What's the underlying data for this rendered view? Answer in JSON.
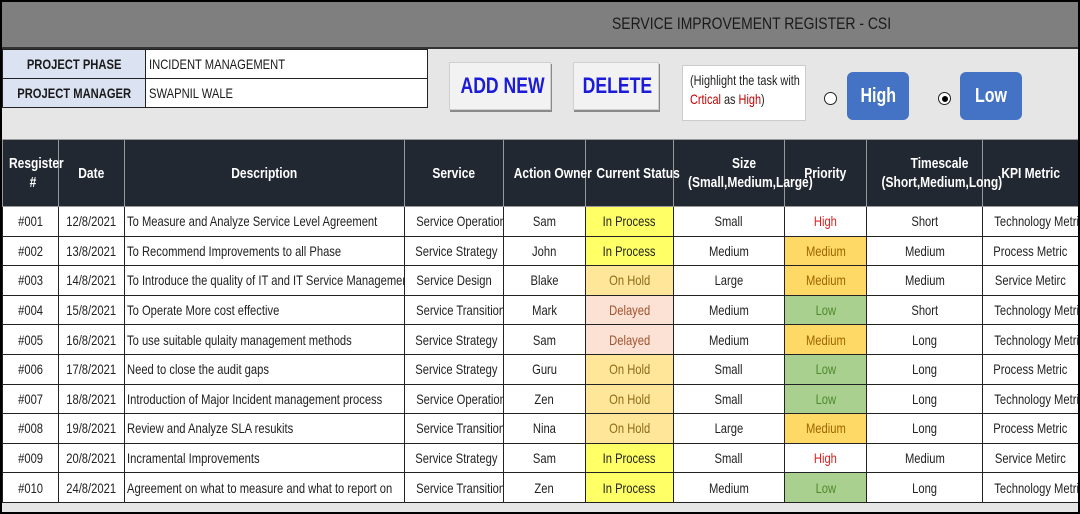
{
  "header": {
    "title": "SERVICE IMPROVEMENT REGISTER - CSI"
  },
  "project": {
    "phase_label": "PROJECT PHASE",
    "phase_value": "INCIDENT MANAGEMENT",
    "manager_label": "PROJECT MANAGER",
    "manager_value": "SWAPNIL WALE"
  },
  "toolbar": {
    "add_label": "ADD NEW",
    "delete_label": "DELETE",
    "note_line1": "(Highlight the task with",
    "note_critical": "Crtical",
    "note_as": " as ",
    "note_high": "High",
    "note_close": ")",
    "high_label": "High",
    "low_label": "Low",
    "selected_option": "Low"
  },
  "table": {
    "columns": [
      "Resgister #",
      "Date",
      "Description",
      "Service",
      "Action Owner",
      "Current Status",
      "Size (Small,Medium,Large)",
      "Priority",
      "Timescale (Short,Medium,Long)",
      "KPI Metric"
    ],
    "rows": [
      [
        "#001",
        "12/8/2021",
        "To Measure and Analyze Service Level Agreement",
        "Service Operation",
        "Sam",
        "In Process",
        "Small",
        "High",
        "Short",
        "Technology Metric"
      ],
      [
        "#002",
        "13/8/2021",
        "To Recommend Improvements to all Phase",
        "Service Strategy",
        "John",
        "In Process",
        "Medium",
        "Medium",
        "Medium",
        "Process Metric"
      ],
      [
        "#003",
        "14/8/2021",
        "To Introduce the quality of IT and IT Service Management Service",
        "Service Design",
        "Blake",
        "On Hold",
        "Large",
        "Medium",
        "Medium",
        "Service Metirc"
      ],
      [
        "#004",
        "15/8/2021",
        "To Operate More cost effective",
        "Service Transition",
        "Mark",
        "Delayed",
        "Medium",
        "Low",
        "Short",
        "Technology Metric"
      ],
      [
        "#005",
        "16/8/2021",
        "To use suitable qulaity management methods",
        "Service Strategy",
        "Sam",
        "Delayed",
        "Medium",
        "Medium",
        "Long",
        "Technology Metric"
      ],
      [
        "#006",
        "17/8/2021",
        "Need to close the audit gaps",
        "Service Strategy",
        "Guru",
        "On Hold",
        "Small",
        "Low",
        "Long",
        "Process Metric"
      ],
      [
        "#007",
        "18/8/2021",
        "Introduction of Major Incident management process",
        "Service Operation",
        "Zen",
        "On Hold",
        "Small",
        "Low",
        "Long",
        "Technology Metric"
      ],
      [
        "#008",
        "19/8/2021",
        "Review and Analyze SLA resukits",
        "Service Transition",
        "Nina",
        "On Hold",
        "Large",
        "Medium",
        "Long",
        "Process Metric"
      ],
      [
        "#009",
        "20/8/2021",
        "Incramental Improvements",
        "Service Strategy",
        "Sam",
        "In Process",
        "Small",
        "High",
        "Medium",
        "Service Metirc"
      ],
      [
        "#010",
        "24/8/2021",
        "Agreement on what to measure and what to report on",
        "Service Transition",
        "Zen",
        "In Process",
        "Medium",
        "Low",
        "Long",
        "Technology Metric"
      ]
    ]
  }
}
